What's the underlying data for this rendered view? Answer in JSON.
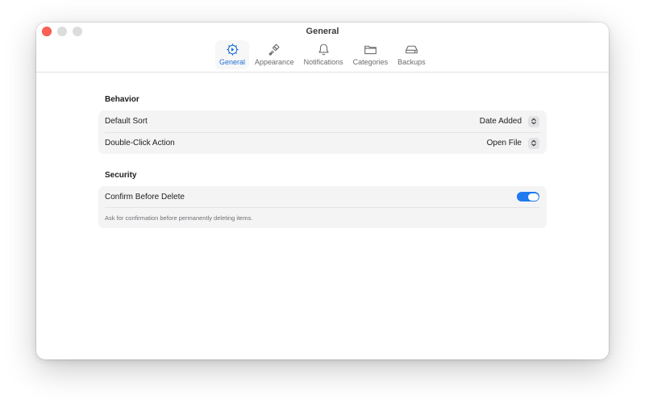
{
  "window": {
    "title": "General"
  },
  "toolbar": {
    "tabs": [
      {
        "label": "General",
        "icon": "gear-icon",
        "active": true
      },
      {
        "label": "Appearance",
        "icon": "paintbrush-icon",
        "active": false
      },
      {
        "label": "Notifications",
        "icon": "bell-icon",
        "active": false
      },
      {
        "label": "Categories",
        "icon": "folder-icon",
        "active": false
      },
      {
        "label": "Backups",
        "icon": "drive-icon",
        "active": false
      }
    ]
  },
  "behavior": {
    "title": "Behavior",
    "default_sort": {
      "label": "Default Sort",
      "value": "Date Added"
    },
    "double_click": {
      "label": "Double-Click Action",
      "value": "Open File"
    }
  },
  "security": {
    "title": "Security",
    "confirm_delete": {
      "label": "Confirm Before Delete",
      "enabled": true
    },
    "hint": "Ask for confirmation before permanently deleting items."
  },
  "colors": {
    "accent": "#1f7aef",
    "close": "#ff5f57",
    "group_bg": "#f4f4f5"
  }
}
